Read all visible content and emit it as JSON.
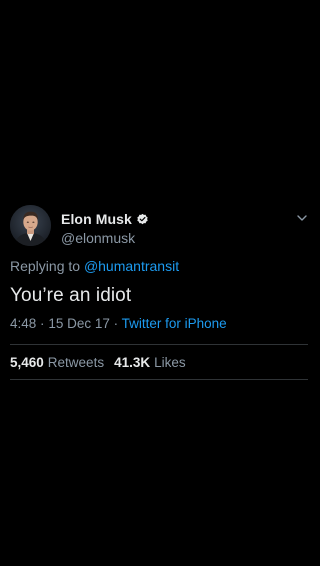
{
  "tweet": {
    "author": {
      "display_name": "Elon Musk",
      "handle": "@elonmusk",
      "avatar_icon": "profile-photo",
      "verified_icon": "verified-badge-icon"
    },
    "menu_icon": "chevron-down-icon",
    "reply_prefix": "Replying to",
    "reply_mention": "@humantransit",
    "text": "You’re an idiot",
    "time": "4:48",
    "separator": "·",
    "date": "15 Dec 17",
    "source_separator": "·",
    "source": "Twitter for iPhone",
    "retweets": {
      "count": "5,460",
      "label": "Retweets"
    },
    "likes": {
      "count": "41.3K",
      "label": "Likes"
    }
  },
  "colors": {
    "background": "#000000",
    "text_primary": "#e7e9ea",
    "text_secondary": "#8b98a5",
    "link": "#1d9bf0",
    "divider": "#2f3336"
  }
}
